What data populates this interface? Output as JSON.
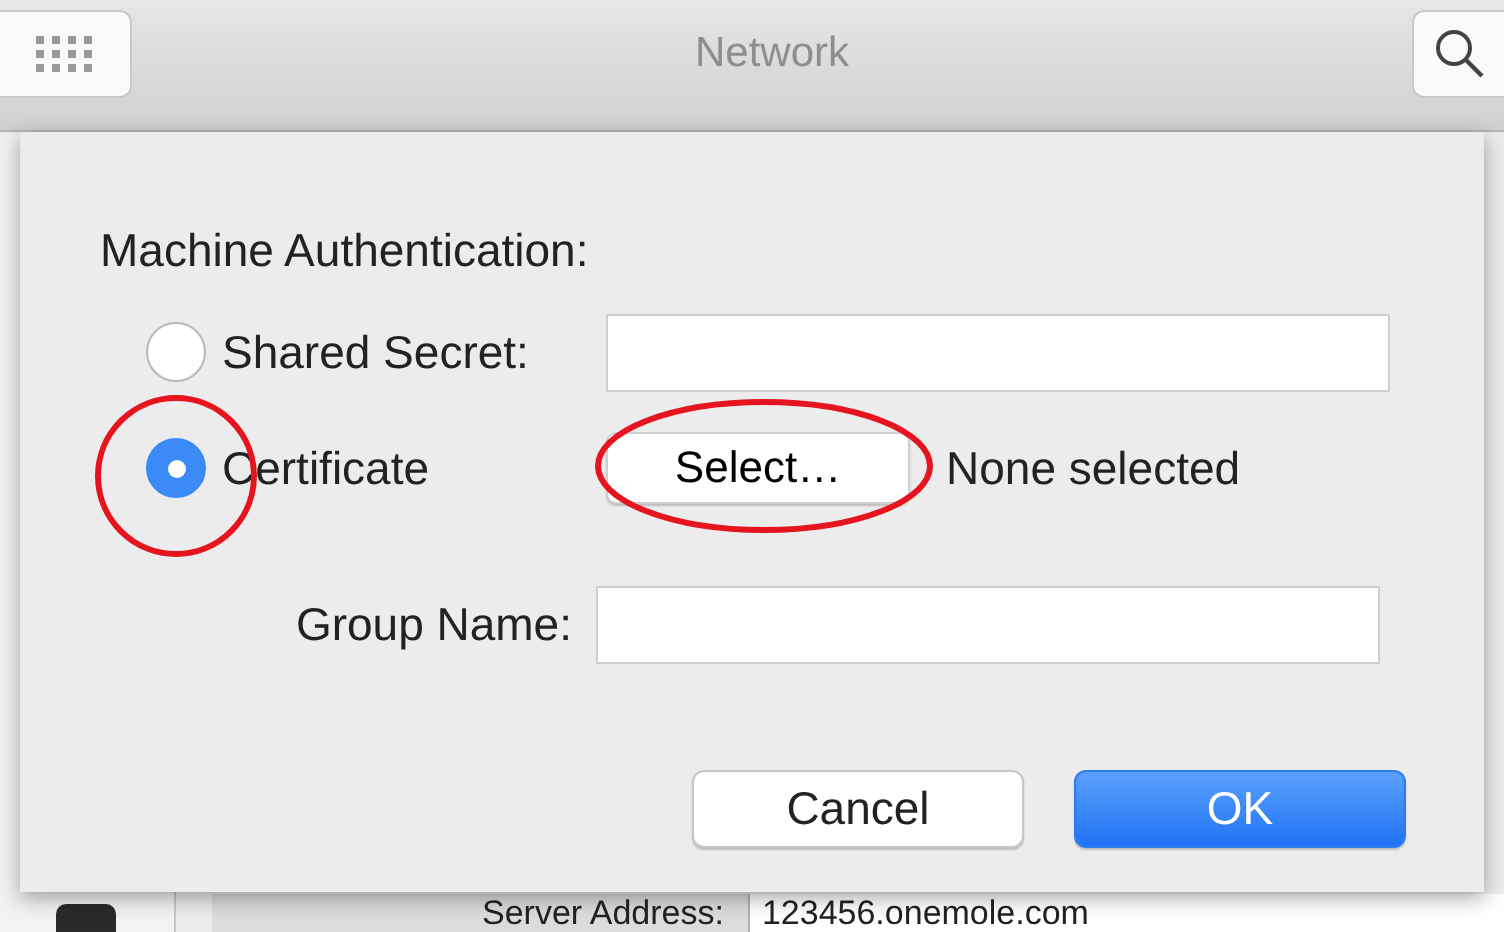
{
  "window": {
    "title": "Network"
  },
  "dialog": {
    "heading": "Machine Authentication:",
    "options": [
      {
        "label": "Shared Secret:",
        "selected": false,
        "circled": false,
        "kind": "field"
      },
      {
        "label": "Certificate",
        "selected": true,
        "circled": true,
        "kind": "chooser",
        "button": "Select…",
        "button_circled": true,
        "status": "None selected"
      }
    ],
    "group_name": {
      "label": "Group Name:"
    },
    "buttons": [
      {
        "label": "Cancel",
        "kind": "secondary"
      },
      {
        "label": "OK",
        "kind": "primary"
      }
    ]
  },
  "background": {
    "server_address": {
      "label": "Server Address:",
      "value": "123456.onemole.com"
    }
  }
}
